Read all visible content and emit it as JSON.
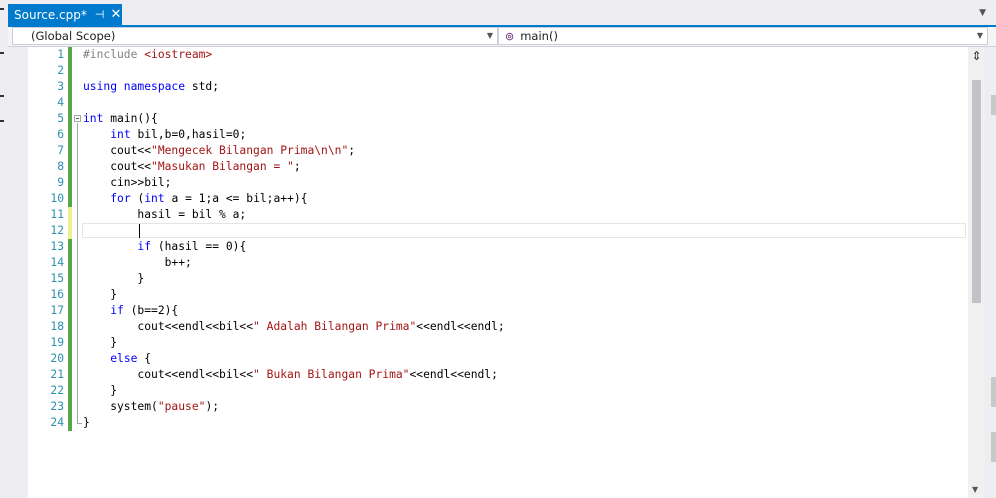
{
  "tab": {
    "title": "Source.cpp*",
    "pin_icon": "pin-icon",
    "close_icon": "close-icon"
  },
  "nav": {
    "scope": "(Global Scope)",
    "member": "main()"
  },
  "lines": [
    {
      "n": "1",
      "code": [
        [
          "pp",
          "#include "
        ],
        [
          "inc",
          "<iostream>"
        ]
      ]
    },
    {
      "n": "2",
      "code": []
    },
    {
      "n": "3",
      "code": [
        [
          "kw",
          "using namespace "
        ],
        [
          "",
          "std;"
        ]
      ]
    },
    {
      "n": "4",
      "code": []
    },
    {
      "n": "5",
      "code": [
        [
          "kw",
          "int "
        ],
        [
          "",
          "main(){"
        ]
      ]
    },
    {
      "n": "6",
      "code": [
        [
          "",
          "    "
        ],
        [
          "kw",
          "int "
        ],
        [
          "",
          "bil,b=0,hasil=0;"
        ]
      ]
    },
    {
      "n": "7",
      "code": [
        [
          "",
          "    cout<<"
        ],
        [
          "str",
          "\"Mengecek Bilangan Prima\\n\\n\""
        ],
        [
          "",
          ";"
        ]
      ]
    },
    {
      "n": "8",
      "code": [
        [
          "",
          "    cout<<"
        ],
        [
          "str",
          "\"Masukan Bilangan = \""
        ],
        [
          "",
          ";"
        ]
      ]
    },
    {
      "n": "9",
      "code": [
        [
          "",
          "    cin>>bil;"
        ]
      ]
    },
    {
      "n": "10",
      "code": [
        [
          "",
          "    "
        ],
        [
          "kw",
          "for "
        ],
        [
          "",
          "("
        ],
        [
          "kw",
          "int "
        ],
        [
          "",
          "a = 1;a <= bil;a++){"
        ]
      ]
    },
    {
      "n": "11",
      "code": [
        [
          "",
          "        hasil = bil % a;"
        ]
      ]
    },
    {
      "n": "12",
      "code": []
    },
    {
      "n": "13",
      "code": [
        [
          "",
          "        "
        ],
        [
          "kw",
          "if "
        ],
        [
          "",
          "(hasil == 0){"
        ]
      ]
    },
    {
      "n": "14",
      "code": [
        [
          "",
          "            b++;"
        ]
      ]
    },
    {
      "n": "15",
      "code": [
        [
          "",
          "        }"
        ]
      ]
    },
    {
      "n": "16",
      "code": [
        [
          "",
          "    }"
        ]
      ]
    },
    {
      "n": "17",
      "code": [
        [
          "",
          "    "
        ],
        [
          "kw",
          "if "
        ],
        [
          "",
          "(b==2){"
        ]
      ]
    },
    {
      "n": "18",
      "code": [
        [
          "",
          "        cout<<endl<<bil<<"
        ],
        [
          "str",
          "\" Adalah Bilangan Prima\""
        ],
        [
          "",
          "<<endl<<endl;"
        ]
      ]
    },
    {
      "n": "19",
      "code": [
        [
          "",
          "    }"
        ]
      ]
    },
    {
      "n": "20",
      "code": [
        [
          "",
          "    "
        ],
        [
          "kw",
          "else "
        ],
        [
          "",
          "{"
        ]
      ]
    },
    {
      "n": "21",
      "code": [
        [
          "",
          "        cout<<endl<<bil<<"
        ],
        [
          "str",
          "\" Bukan Bilangan Prima\""
        ],
        [
          "",
          "<<endl<<endl;"
        ]
      ]
    },
    {
      "n": "22",
      "code": [
        [
          "",
          "    }"
        ]
      ]
    },
    {
      "n": "23",
      "code": [
        [
          "",
          "    system("
        ],
        [
          "str",
          "\"pause\""
        ],
        [
          "",
          ");"
        ]
      ]
    },
    {
      "n": "24",
      "code": [
        [
          "",
          "}"
        ]
      ]
    }
  ],
  "colors": {
    "accent": "#007acc",
    "saved_change": "#57a64a",
    "unsaved_change": "#efef8f",
    "keyword": "#0000ff",
    "string": "#a31515",
    "line_number": "#2b91af"
  }
}
